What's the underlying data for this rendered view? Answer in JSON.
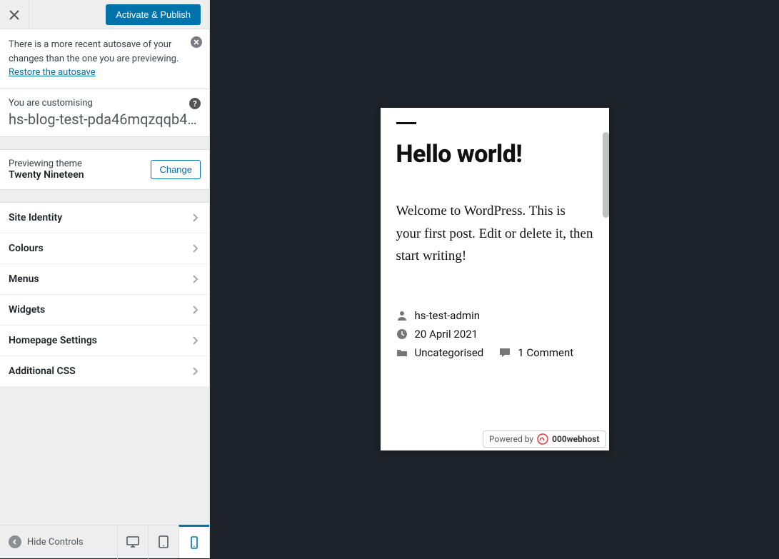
{
  "header": {
    "publish_label": "Activate & Publish"
  },
  "notice": {
    "text_before": "There is a more recent autosave of your changes than the one you are previewing. ",
    "link_text": "Restore the autosave"
  },
  "customising": {
    "label": "You are customising",
    "site_name": "hs-blog-test-pda46mqzqqb4…"
  },
  "theme": {
    "label": "Previewing theme",
    "name": "Twenty Nineteen",
    "change_label": "Change"
  },
  "panels": [
    {
      "label": "Site Identity"
    },
    {
      "label": "Colours"
    },
    {
      "label": "Menus"
    },
    {
      "label": "Widgets"
    },
    {
      "label": "Homepage Settings"
    },
    {
      "label": "Additional CSS"
    }
  ],
  "footer": {
    "hide_label": "Hide Controls"
  },
  "preview": {
    "title": "Hello world!",
    "body": "Welcome to WordPress. This is your first post. Edit or delete it, then start writing!",
    "author": "hs-test-admin",
    "date": "20 April 2021",
    "category": "Uncategorised",
    "comments": "1 Comment",
    "powered_label": "Powered by",
    "powered_brand": "000webhost"
  }
}
